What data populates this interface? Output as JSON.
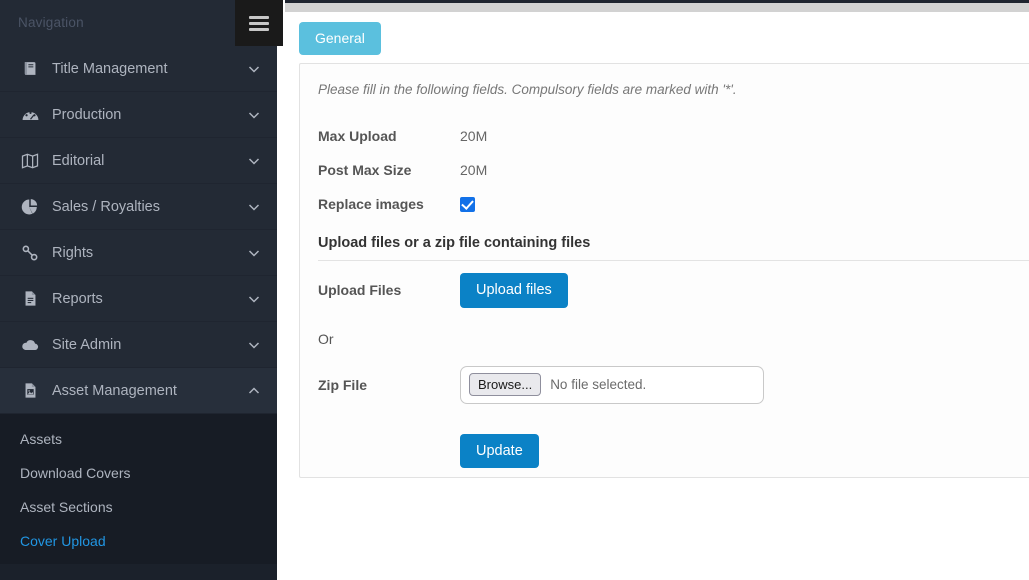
{
  "sidebar": {
    "header": "Navigation",
    "menu_toggle_icon": "hamburger-icon",
    "items": [
      {
        "label": "Title Management",
        "icon": "book-icon",
        "chevron": "chevron-down-icon",
        "expanded": false
      },
      {
        "label": "Production",
        "icon": "gauge-icon",
        "chevron": "chevron-down-icon",
        "expanded": false
      },
      {
        "label": "Editorial",
        "icon": "map-icon",
        "chevron": "chevron-down-icon",
        "expanded": false
      },
      {
        "label": "Sales / Royalties",
        "icon": "pie-chart-icon",
        "chevron": "chevron-down-icon",
        "expanded": false
      },
      {
        "label": "Rights",
        "icon": "link-chain-icon",
        "chevron": "chevron-down-icon",
        "expanded": false
      },
      {
        "label": "Reports",
        "icon": "file-text-icon",
        "chevron": "chevron-down-icon",
        "expanded": false
      },
      {
        "label": "Site Admin",
        "icon": "cloud-icon",
        "chevron": "chevron-down-icon",
        "expanded": false
      },
      {
        "label": "Asset Management",
        "icon": "file-image-icon",
        "chevron": "chevron-up-icon",
        "expanded": true
      }
    ],
    "submenu": [
      {
        "label": "Assets",
        "active": false
      },
      {
        "label": "Download Covers",
        "active": false
      },
      {
        "label": "Asset Sections",
        "active": false
      },
      {
        "label": "Cover Upload",
        "active": true
      }
    ]
  },
  "main": {
    "tab_label": "General",
    "hint": "Please fill in the following fields. Compulsory fields are marked with '*'.",
    "fields": {
      "max_upload_label": "Max Upload",
      "max_upload_value": "20M",
      "post_max_size_label": "Post Max Size",
      "post_max_size_value": "20M",
      "replace_images_label": "Replace images",
      "replace_images_checked": "true"
    },
    "section_heading": "Upload files or a zip file containing files",
    "upload_files_label": "Upload Files",
    "upload_files_button": "Upload files",
    "or_label": "Or",
    "zip_file_label": "Zip File",
    "browse_button": "Browse...",
    "no_file_text": "No file selected.",
    "update_button": "Update"
  },
  "colors": {
    "sidebar_bg": "#232a35",
    "submenu_bg": "#171c25",
    "active_link": "#2196e3",
    "tab_bg": "#5bc0de",
    "primary_button": "#0b82c6",
    "checkbox": "#1271e8"
  }
}
